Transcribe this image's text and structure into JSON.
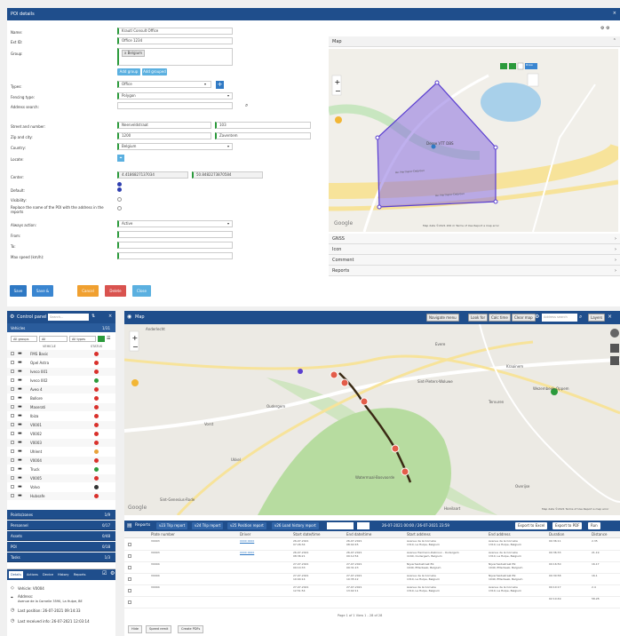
{
  "poi": {
    "title": "POI details",
    "fields": {
      "name_label": "Name:",
      "name_value": "Krautl Consult Office",
      "extid_label": "Ext ID:",
      "extid_value": "Office 1234",
      "group_label": "Group:",
      "group_value": "x Belgium",
      "add_group": "Add group",
      "add_all": "Add grouped",
      "types_label": "Types:",
      "types_value": "Office",
      "fencing_label": "Fencing type:",
      "fencing_value": "Polygon",
      "address_search_label": "Address search:",
      "street_label": "Street and number:",
      "street_value": "Neerveldstraat",
      "street_no": "103",
      "zip_label": "Zip and city:",
      "zip_value": "1200",
      "city_value": "Zaventem",
      "country_label": "Country:",
      "country_value": "Belgium",
      "locate_label": "Locate:",
      "center_label": "Center:",
      "center_lat": "4.4186827137034",
      "center_lng": "50.8482273870584",
      "default_label": "Default:",
      "visibility_label": "Visibility:",
      "replace_label": "Replace the name of the POI with the address in the reports",
      "always_action_label": "Always action:",
      "always_action_value": "Active",
      "from_label": "From:",
      "to_label": "To:",
      "max_speed_label": "Max speed (km/h):"
    },
    "buttons": {
      "save": "Save",
      "save_close": "Save & close",
      "cancel": "Cancel",
      "delete": "Delete",
      "close": "Close"
    },
    "map": {
      "title": "Map",
      "street_overlay": "Draw",
      "google": "Google",
      "footer": "Map data ©2021   200 m        Terms of Use   Report a map error",
      "label_poi": "Desse VTT DBS",
      "road_1": "Av. Hermann-Debroux",
      "road_2": "Av. Hermann-Debroux"
    },
    "accordion": [
      "GNSS",
      "Icon",
      "Comment",
      "Reports"
    ]
  },
  "control_panel": {
    "title": "Control panel",
    "search_placeholder": "Search...",
    "vehicles_label": "Vehicles",
    "vehicles_count": "1/31",
    "filters": [
      "All groups",
      "All",
      "All types"
    ],
    "col_vehicle": "VEHICLE",
    "col_status": "STATUS",
    "vehicles": [
      {
        "name": "FMS Basic",
        "status": "#d9302b"
      },
      {
        "name": "Opel Astra",
        "status": "#d9302b"
      },
      {
        "name": "Iveco 001",
        "status": "#d9302b"
      },
      {
        "name": "Iveco 002",
        "status": "#2b9a3b"
      },
      {
        "name": "Aveo 4",
        "status": "#d9302b"
      },
      {
        "name": "Bollore",
        "status": "#d9302b"
      },
      {
        "name": "Maserati",
        "status": "#d9302b"
      },
      {
        "name": "Ibiza",
        "status": "#d9302b"
      },
      {
        "name": "V0001",
        "status": "#d9302b"
      },
      {
        "name": "V0002",
        "status": "#d9302b"
      },
      {
        "name": "V0003",
        "status": "#d9302b"
      },
      {
        "name": "Uhlent",
        "status": "#e8a33a"
      },
      {
        "name": "V0004",
        "status": "#d9302b"
      },
      {
        "name": "Truck",
        "status": "#2b9a3b"
      },
      {
        "name": "V0005",
        "status": "#d9302b"
      },
      {
        "name": "Volvo",
        "status": "#333333"
      },
      {
        "name": "Hubsafe",
        "status": "#d9302b"
      }
    ],
    "sections": [
      {
        "label": "Points/zones",
        "count": "1/9"
      },
      {
        "label": "Personnel",
        "count": "0/17"
      },
      {
        "label": "Assets",
        "count": "0/48"
      },
      {
        "label": "POI",
        "count": "0/18"
      },
      {
        "label": "Tasks",
        "count": "1/3"
      }
    ],
    "info_tabs": [
      "Details",
      "Actions",
      "Device",
      "History",
      "Reports"
    ],
    "info": {
      "vehicle": "Vehicle: V0004",
      "address_label": "Address:",
      "address": "Avenue de la Cornelie 3590, La Hulpe, BE",
      "last_position": "Last position: 26-07-2021 09:14:33",
      "last_received": "Last received info: 26-07-2021 12:03:14"
    }
  },
  "map2": {
    "title": "Map",
    "toolbar": [
      "Navigate menu",
      "Look for",
      "Calc time",
      "Clear map"
    ],
    "search_placeholder": "Address search",
    "layers": "Layers",
    "places": [
      "Anderlecht",
      "Evere",
      "Kraainem",
      "Wezembeek-Oppem",
      "Sint-Pieters-Woluwe",
      "Tervuren",
      "Oudergem",
      "Vorst",
      "Ukkel",
      "Watermaal-Bosvoorde",
      "Sint-Genesius-Rode",
      "Overijse",
      "Hoeilaart"
    ],
    "google": "Google",
    "footer": "Map data ©2021   Terms of Use   Report a map error"
  },
  "reports": {
    "title": "Reports",
    "tabs": [
      "v23 Trip report",
      "v24 Trip report",
      "v25 Position report",
      "v26 Load history report"
    ],
    "date_range": "26-07-2021 00:00 / 26-07-2021 23:59",
    "export_buttons": [
      "Export to Excel",
      "Export to PDF"
    ],
    "run_button": "Run",
    "columns": [
      "Plate number",
      "Driver",
      "Start date/time",
      "End date/time",
      "Start address",
      "End address",
      "Duration",
      "Distance"
    ],
    "rows": [
      {
        "plate": "V0003",
        "driver": "0000 0000",
        "start": "26-07-2021\n07:26:34",
        "end": "26-07-2021\n08:02:45",
        "saddr": "Avenue de la Cornelie\n1310, La Hulpe, Belgium",
        "eaddr": "Avenue de la Cornelie\n1310, La Hulpe, Belgium",
        "dur": "00:36:11",
        "dist": "2.35"
      },
      {
        "plate": "V0003",
        "driver": "0000 0000",
        "start": "26-07-2021\n08:36:21",
        "end": "26-07-2021\n09:12:54",
        "saddr": "Avenue Hermann-Debroux - Oudergem\n1160, Oudergem, Belgium",
        "eaddr": "Avenue de la Cornelie\n1310, La Hulpe, Belgium",
        "dur": "00:36:33",
        "dist": "21.19"
      },
      {
        "plate": "V0004",
        "driver": "",
        "start": "27-07-2021\n09:14:33",
        "end": "27-07-2021\n09:31:23",
        "saddr": "Nijverheidsstraat 89\n1040, Etterbeek, Belgium",
        "eaddr": "Nijverheidsstraat 89\n1040, Etterbeek, Belgium",
        "dur": "00:16:50",
        "dist": "16.17"
      },
      {
        "plate": "V0004",
        "driver": "",
        "start": "27-07-2021\n10:04:14",
        "end": "27-07-2021\n10:35:12",
        "saddr": "Avenue de la Cornelie\n1310, La Hulpe, Belgium",
        "eaddr": "Nijverheidsstraat 89\n1040, Etterbeek, Belgium",
        "dur": "00:30:58",
        "dist": "16.1"
      },
      {
        "plate": "V0004",
        "driver": "",
        "start": "27-07-2021\n12:51:54",
        "end": "27-07-2021\n13:02:11",
        "saddr": "Avenue de la Cornelie\n1310, La Hulpe, Belgium",
        "eaddr": "Avenue de la Cornelie\n1310, La Hulpe, Belgium",
        "dur": "00:10:17",
        "dist": "2.4"
      },
      {
        "plate": "",
        "driver": "",
        "start": "",
        "end": "",
        "saddr": "",
        "eaddr": "",
        "dur": "02:10:49",
        "dist": "58.28"
      }
    ],
    "pager": "Page 1 of 1   View 1 - 28 of 28",
    "bottom_buttons": [
      "Hide",
      "Speed remit",
      "Create PDFs"
    ]
  },
  "colors": {
    "brand_blue": "#1f4e8c",
    "save_blue": "#2f79c4",
    "save_close_blue": "#3a86d1",
    "cancel_orange": "#f0a030",
    "delete_red": "#d9534f",
    "close_light_blue": "#5bb0e0",
    "poi_polygon": "#8a6fe0"
  }
}
